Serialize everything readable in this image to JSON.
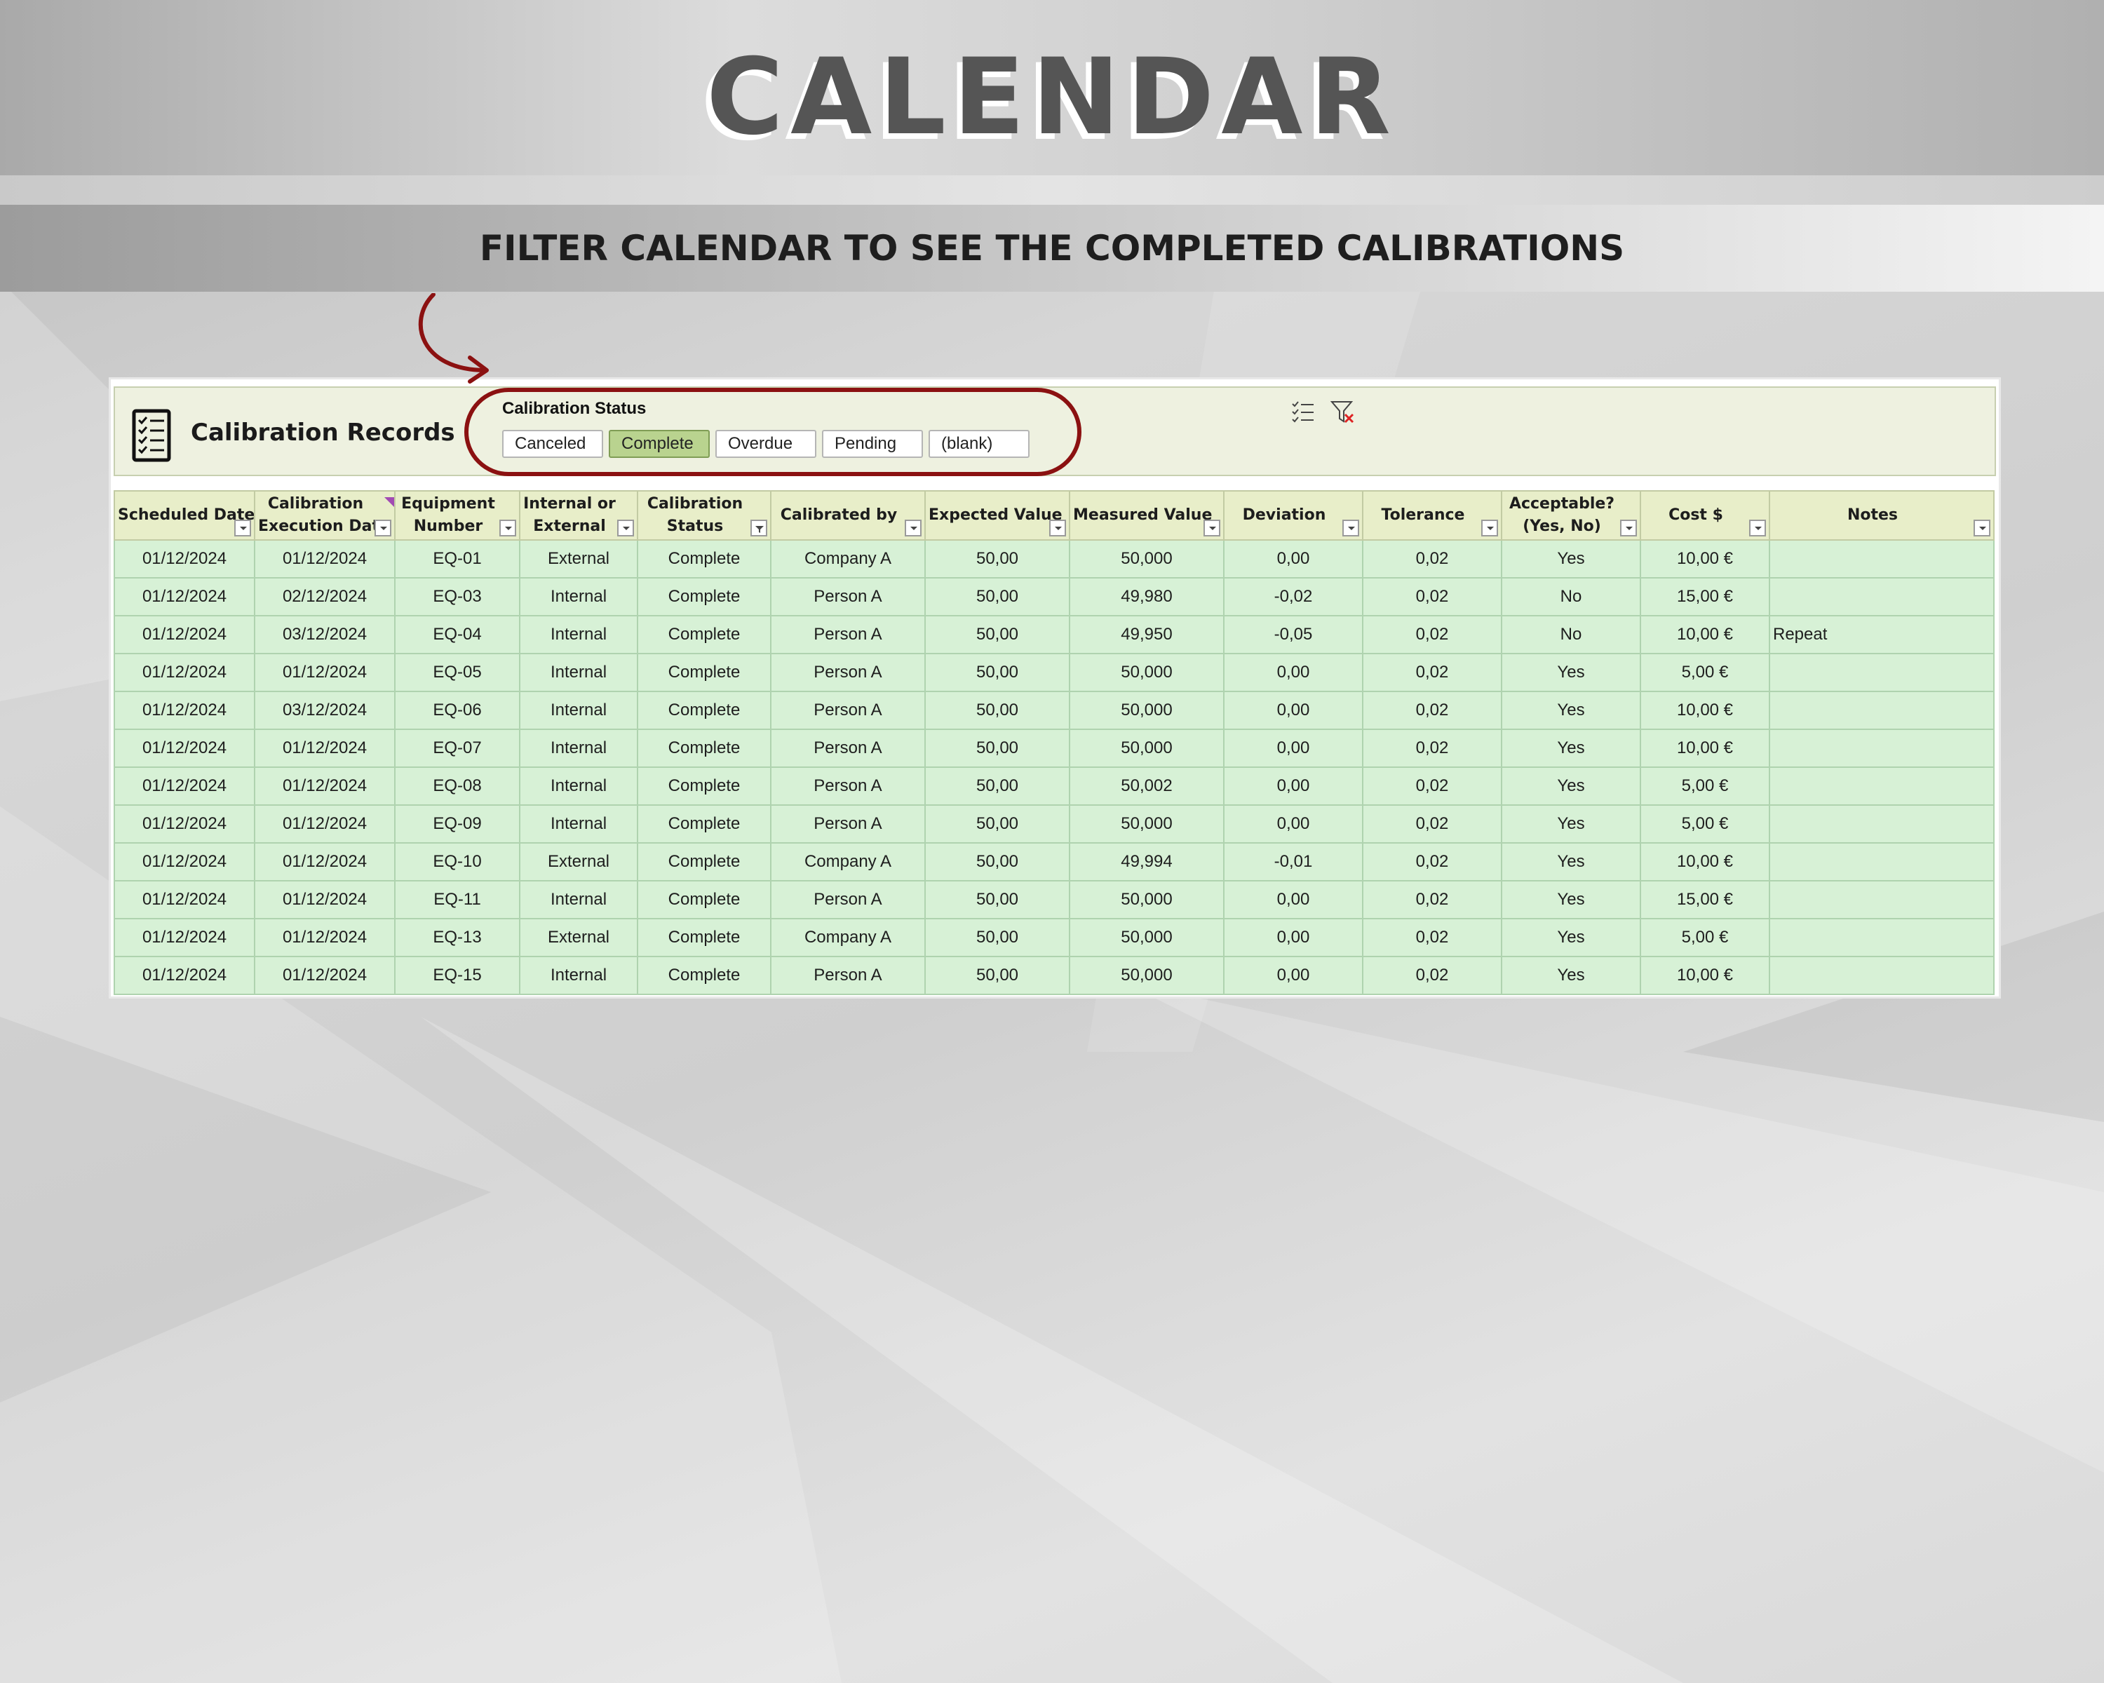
{
  "page": {
    "title": "CALENDAR",
    "subtitle": "FILTER CALENDAR TO SEE THE COMPLETED CALIBRATIONS"
  },
  "colors": {
    "oval": "#8b1111",
    "banner": "#eef1e0",
    "header_fill": "#e8eec9",
    "row_fill": "#d7f1d6",
    "selected_slicer": "#b9d38f"
  },
  "sheet": {
    "title": "Calibration Records",
    "title_icon": "checklist-icon",
    "slicer": {
      "label": "Calibration Status",
      "options": [
        "Canceled",
        "Complete",
        "Overdue",
        "Pending",
        "(blank)"
      ],
      "selected": "Complete",
      "tools": [
        "multi-select-icon",
        "clear-filter-icon"
      ]
    },
    "columns": [
      {
        "line1": "Scheduled Date",
        "line2": ""
      },
      {
        "line1": "Calibration",
        "line2": "Execution Dat"
      },
      {
        "line1": "Equipment",
        "line2": "Number"
      },
      {
        "line1": "Internal or",
        "line2": "External"
      },
      {
        "line1": "Calibration",
        "line2": "Status"
      },
      {
        "line1": "Calibrated by",
        "line2": ""
      },
      {
        "line1": "Expected Value",
        "line2": ""
      },
      {
        "line1": "Measured Value",
        "line2": ""
      },
      {
        "line1": "Deviation",
        "line2": ""
      },
      {
        "line1": "Tolerance",
        "line2": ""
      },
      {
        "line1": "Acceptable?",
        "line2": "(Yes, No)"
      },
      {
        "line1": "Cost $",
        "line2": ""
      },
      {
        "line1": "Notes",
        "line2": ""
      }
    ],
    "rows": [
      [
        "01/12/2024",
        "01/12/2024",
        "EQ-01",
        "External",
        "Complete",
        "Company A",
        "50,00",
        "50,000",
        "0,00",
        "0,02",
        "Yes",
        "10,00 €",
        ""
      ],
      [
        "01/12/2024",
        "02/12/2024",
        "EQ-03",
        "Internal",
        "Complete",
        "Person A",
        "50,00",
        "49,980",
        "-0,02",
        "0,02",
        "No",
        "15,00 €",
        ""
      ],
      [
        "01/12/2024",
        "03/12/2024",
        "EQ-04",
        "Internal",
        "Complete",
        "Person A",
        "50,00",
        "49,950",
        "-0,05",
        "0,02",
        "No",
        "10,00 €",
        "Repeat"
      ],
      [
        "01/12/2024",
        "01/12/2024",
        "EQ-05",
        "Internal",
        "Complete",
        "Person A",
        "50,00",
        "50,000",
        "0,00",
        "0,02",
        "Yes",
        "5,00 €",
        ""
      ],
      [
        "01/12/2024",
        "03/12/2024",
        "EQ-06",
        "Internal",
        "Complete",
        "Person A",
        "50,00",
        "50,000",
        "0,00",
        "0,02",
        "Yes",
        "10,00 €",
        ""
      ],
      [
        "01/12/2024",
        "01/12/2024",
        "EQ-07",
        "Internal",
        "Complete",
        "Person A",
        "50,00",
        "50,000",
        "0,00",
        "0,02",
        "Yes",
        "10,00 €",
        ""
      ],
      [
        "01/12/2024",
        "01/12/2024",
        "EQ-08",
        "Internal",
        "Complete",
        "Person A",
        "50,00",
        "50,002",
        "0,00",
        "0,02",
        "Yes",
        "5,00 €",
        ""
      ],
      [
        "01/12/2024",
        "01/12/2024",
        "EQ-09",
        "Internal",
        "Complete",
        "Person A",
        "50,00",
        "50,000",
        "0,00",
        "0,02",
        "Yes",
        "5,00 €",
        ""
      ],
      [
        "01/12/2024",
        "01/12/2024",
        "EQ-10",
        "External",
        "Complete",
        "Company A",
        "50,00",
        "49,994",
        "-0,01",
        "0,02",
        "Yes",
        "10,00 €",
        ""
      ],
      [
        "01/12/2024",
        "01/12/2024",
        "EQ-11",
        "Internal",
        "Complete",
        "Person A",
        "50,00",
        "50,000",
        "0,00",
        "0,02",
        "Yes",
        "15,00 €",
        ""
      ],
      [
        "01/12/2024",
        "01/12/2024",
        "EQ-13",
        "External",
        "Complete",
        "Company A",
        "50,00",
        "50,000",
        "0,00",
        "0,02",
        "Yes",
        "5,00 €",
        ""
      ],
      [
        "01/12/2024",
        "01/12/2024",
        "EQ-15",
        "Internal",
        "Complete",
        "Person A",
        "50,00",
        "50,000",
        "0,00",
        "0,02",
        "Yes",
        "10,00 €",
        ""
      ]
    ]
  }
}
